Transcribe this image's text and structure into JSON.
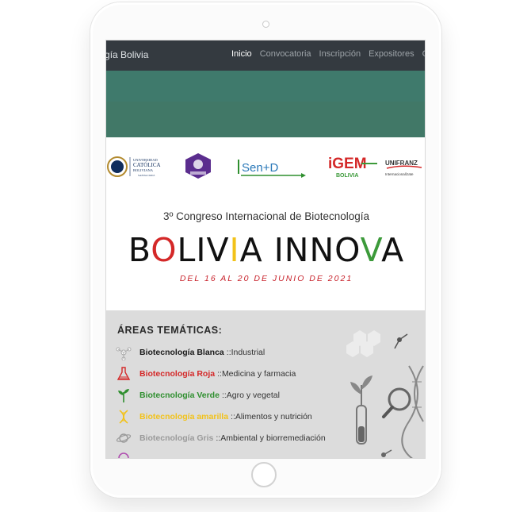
{
  "nav": {
    "brand": "ología Bolivia",
    "links": [
      "Inicio",
      "Convocatoria",
      "Inscripción",
      "Expositores",
      "C"
    ],
    "active_index": 0
  },
  "logos": {
    "ucb": [
      "UNIVERSIDAD",
      "CATÓLICA",
      "BOLIVIANA",
      "SANTA CRUZ"
    ],
    "sen_id": "Sen+D",
    "igem_top": "iGEM",
    "igem_bottom": "BOLIVIA",
    "unifranz": "UNIFRANZ",
    "unifranz_sub": "Internacionalízate"
  },
  "hero": {
    "subtitle": "3º Congreso Internacional de Biotecnología",
    "title_parts": [
      {
        "text": "B",
        "color": "#111111"
      },
      {
        "text": "O",
        "color": "#d42828"
      },
      {
        "text": "LIV",
        "color": "#111111"
      },
      {
        "text": "I",
        "color": "#f2c21a"
      },
      {
        "text": "A INNO",
        "color": "#111111"
      },
      {
        "text": "V",
        "color": "#3c9a3a"
      },
      {
        "text": "A",
        "color": "#111111"
      }
    ],
    "dates": "DEL 16 AL 20 DE JUNIO DE 2021"
  },
  "areas": {
    "title": "ÁREAS TEMÁTICAS:",
    "items": [
      {
        "name": "Biotecnología Blanca",
        "sep": " :: ",
        "desc": "Industrial",
        "color": "#1a1a1a",
        "icon": "molecule-icon"
      },
      {
        "name": "Biotecnología Roja",
        "sep": " :: ",
        "desc": "Medicina y farmacia",
        "color": "#d42828",
        "icon": "flask-icon"
      },
      {
        "name": "Biotecnología Verde",
        "sep": " :: ",
        "desc": "Agro y vegetal",
        "color": "#2f8f2f",
        "icon": "plant-icon"
      },
      {
        "name": "Biotecnología amarilla",
        "sep": " :: ",
        "desc": "Alimentos y nutrición",
        "color": "#f2c21a",
        "icon": "dna-icon"
      },
      {
        "name": "Biotecnología Gris",
        "sep": " :: ",
        "desc": "Ambiental y biorremediación",
        "color": "#9a9a9a",
        "icon": "planet-icon"
      }
    ]
  }
}
